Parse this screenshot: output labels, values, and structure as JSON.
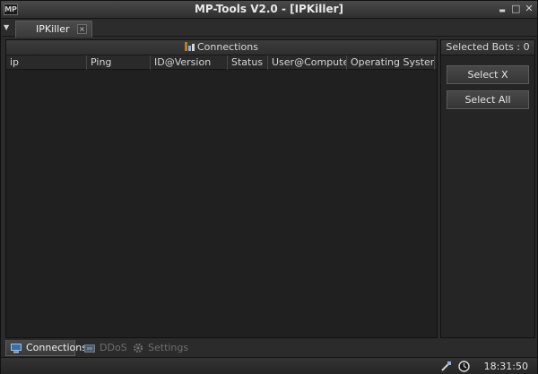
{
  "window": {
    "app_icon_label": "MP",
    "title": "MP-Tools V2.0 - [IPKiller]",
    "min_glyph": "▬",
    "max_glyph": "□",
    "close_glyph": "✕"
  },
  "tabbar": {
    "menu_glyph": "▼",
    "tab_label": "IPKiller",
    "close_glyph": "×"
  },
  "connections": {
    "header": "Connections",
    "columns": [
      "ip",
      "Ping",
      "ID@Version",
      "Status",
      "User@Computer",
      "Operating System"
    ],
    "rows": []
  },
  "side": {
    "header": "Selected Bots : 0",
    "select_x": "Select X",
    "select_all": "Select All"
  },
  "bottom_tabs": [
    {
      "label": "Connections",
      "icon": "connections-icon",
      "active": true
    },
    {
      "label": "DDoS",
      "icon": "ddos-icon",
      "active": false
    },
    {
      "label": "Settings",
      "icon": "gear-icon",
      "active": false
    }
  ],
  "status": {
    "time": "18:31:50"
  },
  "colors": {
    "background": "#1e1e1e",
    "panel": "#2b2b2b",
    "text": "#dcdcdc",
    "inactive_text": "#6e6e6e"
  }
}
